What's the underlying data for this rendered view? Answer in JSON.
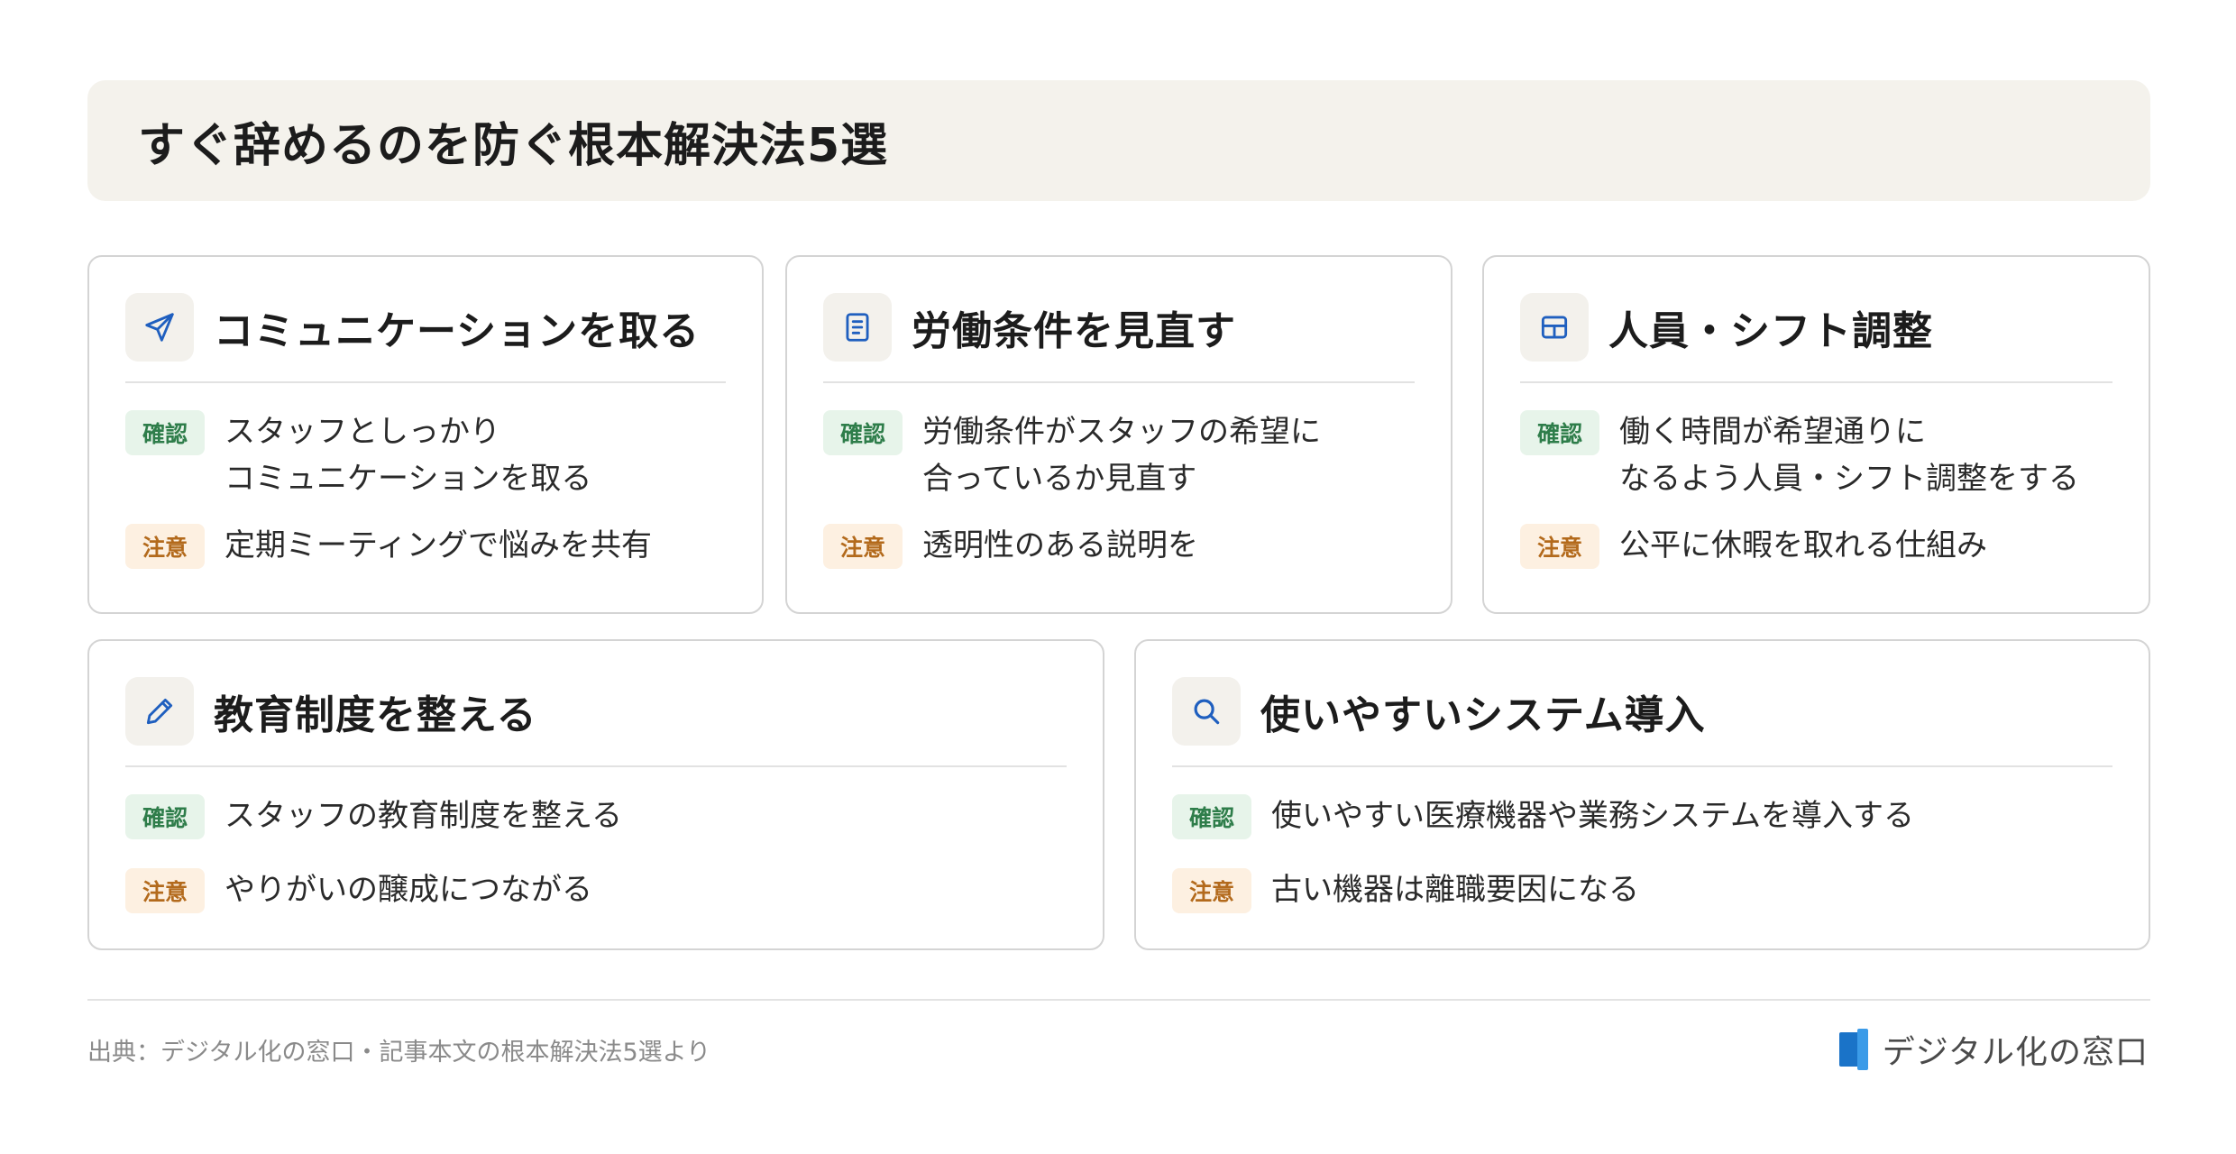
{
  "title": "すぐ辞めるのを防ぐ根本解決法5選",
  "colors": {
    "banner_bg": "#f4f2ec",
    "icon_blue": "#1f5fbf",
    "confirm_bg": "#e7f4ea",
    "confirm_text": "#2e7d4a",
    "caution_bg": "#fdf0e1",
    "caution_text": "#b36a1c"
  },
  "badges": {
    "confirm": "確認",
    "caution": "注意"
  },
  "cards": [
    {
      "icon": "send-icon",
      "title": "コミュニケーションを取る",
      "confirm": "スタッフとしっかり\nコミュニケーションを取る",
      "caution": "定期ミーティングで悩みを共有"
    },
    {
      "icon": "document-icon",
      "title": "労働条件を見直す",
      "confirm": "労働条件がスタッフの希望に\n合っているか見直す",
      "caution": "透明性のある説明を"
    },
    {
      "icon": "grid-icon",
      "title": "人員・シフト調整",
      "confirm": "働く時間が希望通りに\nなるよう人員・シフト調整をする",
      "caution": "公平に休暇を取れる仕組み"
    },
    {
      "icon": "pencil-icon",
      "title": "教育制度を整える",
      "confirm": "スタッフの教育制度を整える",
      "caution": "やりがいの醸成につながる"
    },
    {
      "icon": "search-icon",
      "title": "使いやすいシステム導入",
      "confirm": "使いやすい医療機器や業務システムを導入する",
      "caution": "古い機器は離職要因になる"
    }
  ],
  "footer": {
    "source": "出典：デジタル化の窓口・記事本文の根本解決法5選より",
    "brand": "デジタル化の窓口"
  }
}
